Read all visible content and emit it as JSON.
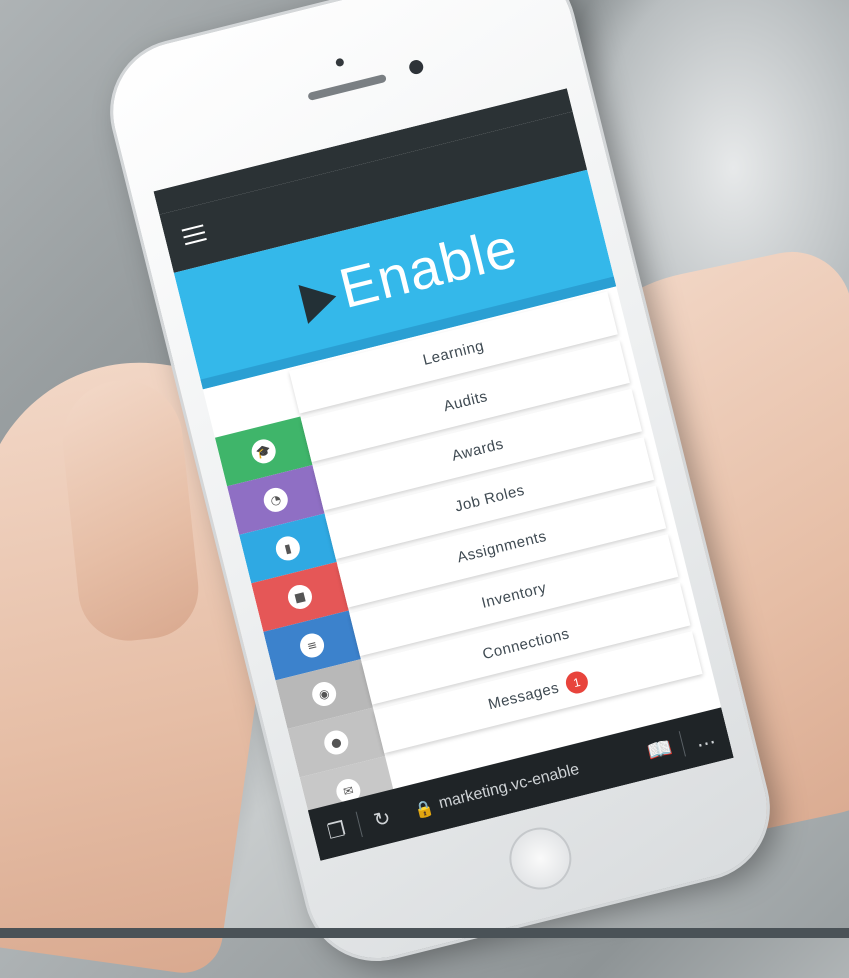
{
  "app": {
    "logo_text": "Enable"
  },
  "colors": {
    "header_blue": "#34b8ea",
    "learning": "#3fb56a",
    "audits": "#8f6fc4",
    "awards": "#2fa9e3",
    "job_roles": "#e55757",
    "assignments": "#3c82cc",
    "gray_tile": "#b8b8b8"
  },
  "menu": {
    "items": [
      {
        "label": "Learning",
        "icon": "graduation-cap-icon",
        "color": "#3fb56a"
      },
      {
        "label": "Audits",
        "icon": "pie-chart-icon",
        "color": "#8f6fc4"
      },
      {
        "label": "Awards",
        "icon": "book-icon",
        "color": "#2fa9e3"
      },
      {
        "label": "Job Roles",
        "icon": "briefcase-icon",
        "color": "#e55757"
      },
      {
        "label": "Assignments",
        "icon": "clipboard-icon",
        "color": "#3c82cc"
      },
      {
        "label": "Inventory",
        "icon": "camera-icon",
        "color": "#b8b8b8"
      },
      {
        "label": "Connections",
        "icon": "people-icon",
        "color": "#b8b8b8"
      },
      {
        "label": "Messages",
        "icon": "envelope-icon",
        "color": "#b8b8b8",
        "badge": "1"
      }
    ]
  },
  "browser": {
    "url": "marketing.vc-enable",
    "more": "..."
  }
}
